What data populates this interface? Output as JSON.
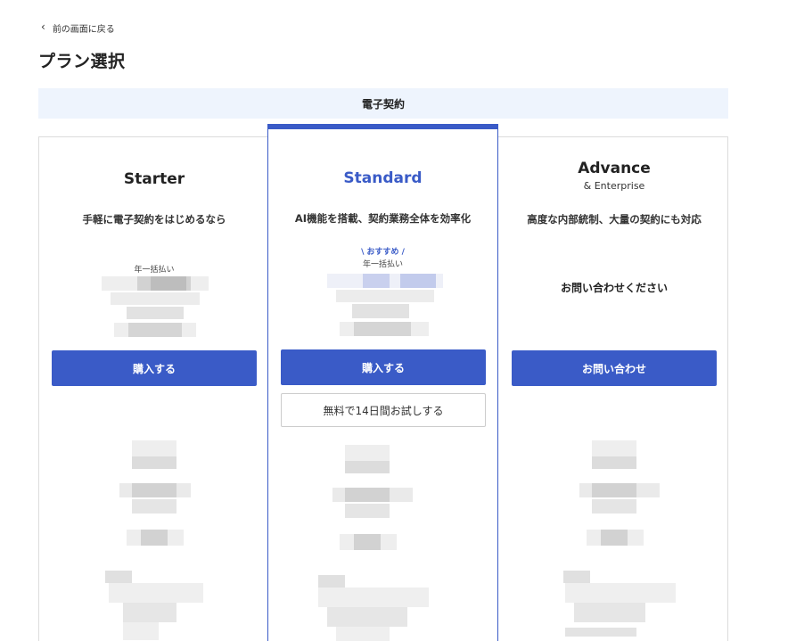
{
  "header": {
    "back_label": "前の画面に戻る",
    "title": "プラン選択"
  },
  "category": {
    "label": "電子契約"
  },
  "plans": [
    {
      "name": "Starter",
      "description": "手軽に電子契約をはじめるなら",
      "billing": "年一括払い",
      "cta_label": "購入する"
    },
    {
      "name": "Standard",
      "description": "AI機能を搭載、契約業務全体を効率化",
      "recommend": "\\ おすすめ /",
      "billing": "年一括払い",
      "cta_label": "購入する",
      "trial_label": "無料で14日間お試しする"
    },
    {
      "name": "Advance",
      "subname": "& Enterprise",
      "description": "高度な内部統制、大量の契約にも対応",
      "contact_note": "お問い合わせください",
      "cta_label": "お問い合わせ"
    }
  ],
  "colors": {
    "accent": "#3a5bc7",
    "category_bg": "#eef4fd",
    "border": "#dcdcdc",
    "redacted_light": "#eeeeee",
    "redacted_mid": "#d9d9d9",
    "redacted_dark": "#bfbfbf",
    "redacted_blue": "#c9d0ee"
  },
  "icons": {
    "back": "chevron-left-icon"
  }
}
